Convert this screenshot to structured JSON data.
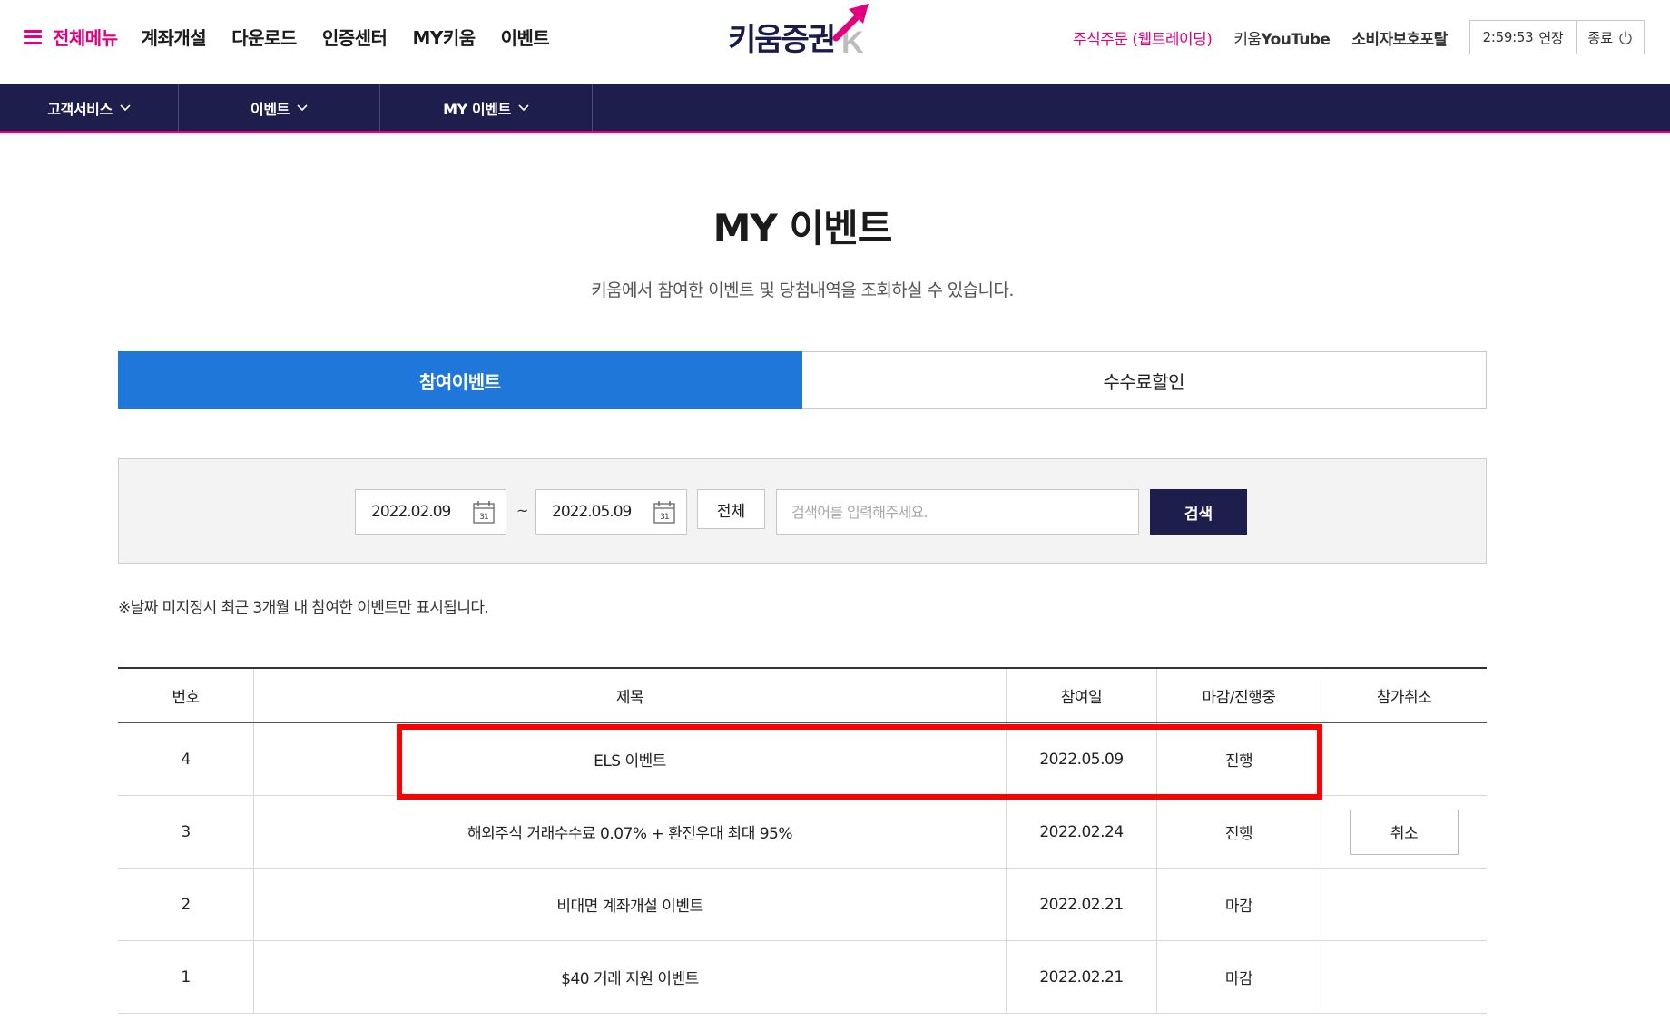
{
  "header": {
    "menu_label": "전체메뉴",
    "nav": [
      "계좌개설",
      "다운로드",
      "인증센터",
      "MY키움",
      "이벤트"
    ],
    "logo_text": "키움증권",
    "order_link": "주식주문 (웹트레이딩)",
    "youtube_prefix": "키움",
    "youtube_brand": "YouTube",
    "consumer_portal": "소비자보호포탈",
    "timer": "2:59:53",
    "extend_label": "연장",
    "logout_label": "종료"
  },
  "gnb": [
    "고객서비스",
    "이벤트",
    "MY 이벤트"
  ],
  "page": {
    "title": "MY 이벤트",
    "subtitle": "키움에서 참여한 이벤트 및 당첨내역을 조회하실 수 있습니다."
  },
  "tabs": [
    {
      "label": "참여이벤트",
      "active": true
    },
    {
      "label": "수수료할인",
      "active": false
    }
  ],
  "search": {
    "start_date": "2022.02.09",
    "end_date": "2022.05.09",
    "calendar_day": "31",
    "tilde": "~",
    "all_label": "전체",
    "placeholder": "검색어를 입력해주세요.",
    "button_label": "검색"
  },
  "notice": "※날짜 미지정시 최근 3개월 내 참여한 이벤트만 표시됩니다.",
  "table": {
    "headers": [
      "번호",
      "제목",
      "참여일",
      "마감/진행중",
      "참가취소"
    ],
    "rows": [
      {
        "no": "4",
        "title": "ELS 이벤트",
        "date": "2022.05.09",
        "status": "진행",
        "cancel": ""
      },
      {
        "no": "3",
        "title": "해외주식 거래수수료 0.07% + 환전우대 최대 95%",
        "date": "2022.02.24",
        "status": "진행",
        "cancel": "취소"
      },
      {
        "no": "2",
        "title": "비대면 계좌개설 이벤트",
        "date": "2022.02.21",
        "status": "마감",
        "cancel": ""
      },
      {
        "no": "1",
        "title": "$40 거래 지원 이벤트",
        "date": "2022.02.21",
        "status": "마감",
        "cancel": ""
      }
    ]
  },
  "colors": {
    "brand_pink": "#e3007f",
    "navy": "#1e1e4c",
    "tab_blue": "#1f77d9",
    "highlight_red": "#ff0000"
  }
}
